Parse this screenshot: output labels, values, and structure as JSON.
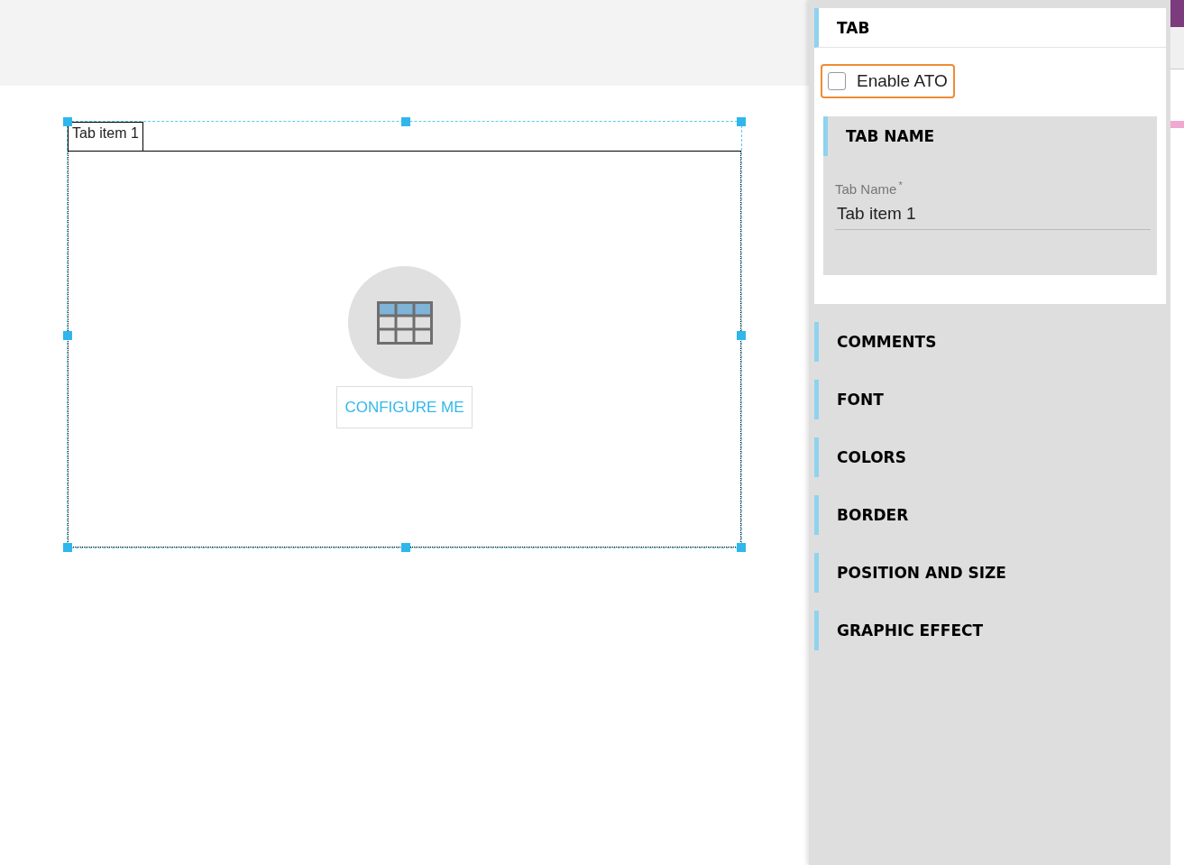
{
  "canvas": {
    "tab_label": "Tab item 1",
    "configure_button": "CONFIGURE ME"
  },
  "panel": {
    "title": "TAB",
    "enable_ato": {
      "label": "Enable ATO",
      "checked": false
    },
    "tab_name_section": {
      "title": "TAB NAME",
      "field_label": "Tab Name",
      "required_mark": "*",
      "value": "Tab item 1"
    },
    "sections": [
      {
        "title": "COMMENTS"
      },
      {
        "title": "FONT"
      },
      {
        "title": "COLORS"
      },
      {
        "title": "BORDER"
      },
      {
        "title": "POSITION AND SIZE"
      },
      {
        "title": "GRAPHIC EFFECT"
      }
    ]
  }
}
